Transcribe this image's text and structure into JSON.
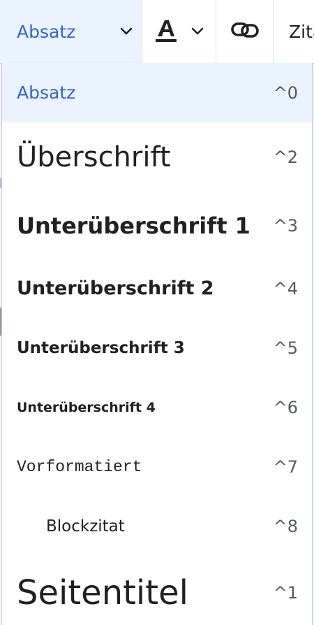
{
  "toolbar": {
    "format_label": "Absatz",
    "style_icon": "text-style-icon",
    "link_icon": "link-icon",
    "cite_label": "Zitat"
  },
  "menu": {
    "items": [
      {
        "label": "Absatz",
        "shortcut": "^0"
      },
      {
        "label": "Überschrift",
        "shortcut": "^2"
      },
      {
        "label": "Unterüberschrift 1",
        "shortcut": "^3"
      },
      {
        "label": "Unterüberschrift 2",
        "shortcut": "^4"
      },
      {
        "label": "Unterüberschrift 3",
        "shortcut": "^5"
      },
      {
        "label": "Unterüberschrift 4",
        "shortcut": "^6"
      },
      {
        "label": "Vorformatiert",
        "shortcut": "^7"
      },
      {
        "label": "Blockzitat",
        "shortcut": "^8"
      },
      {
        "label": "Seitentitel",
        "shortcut": "^1"
      }
    ],
    "selected_index": 0
  },
  "colors": {
    "accent": "#3366cc",
    "selected_bg": "#eaf3ff"
  }
}
